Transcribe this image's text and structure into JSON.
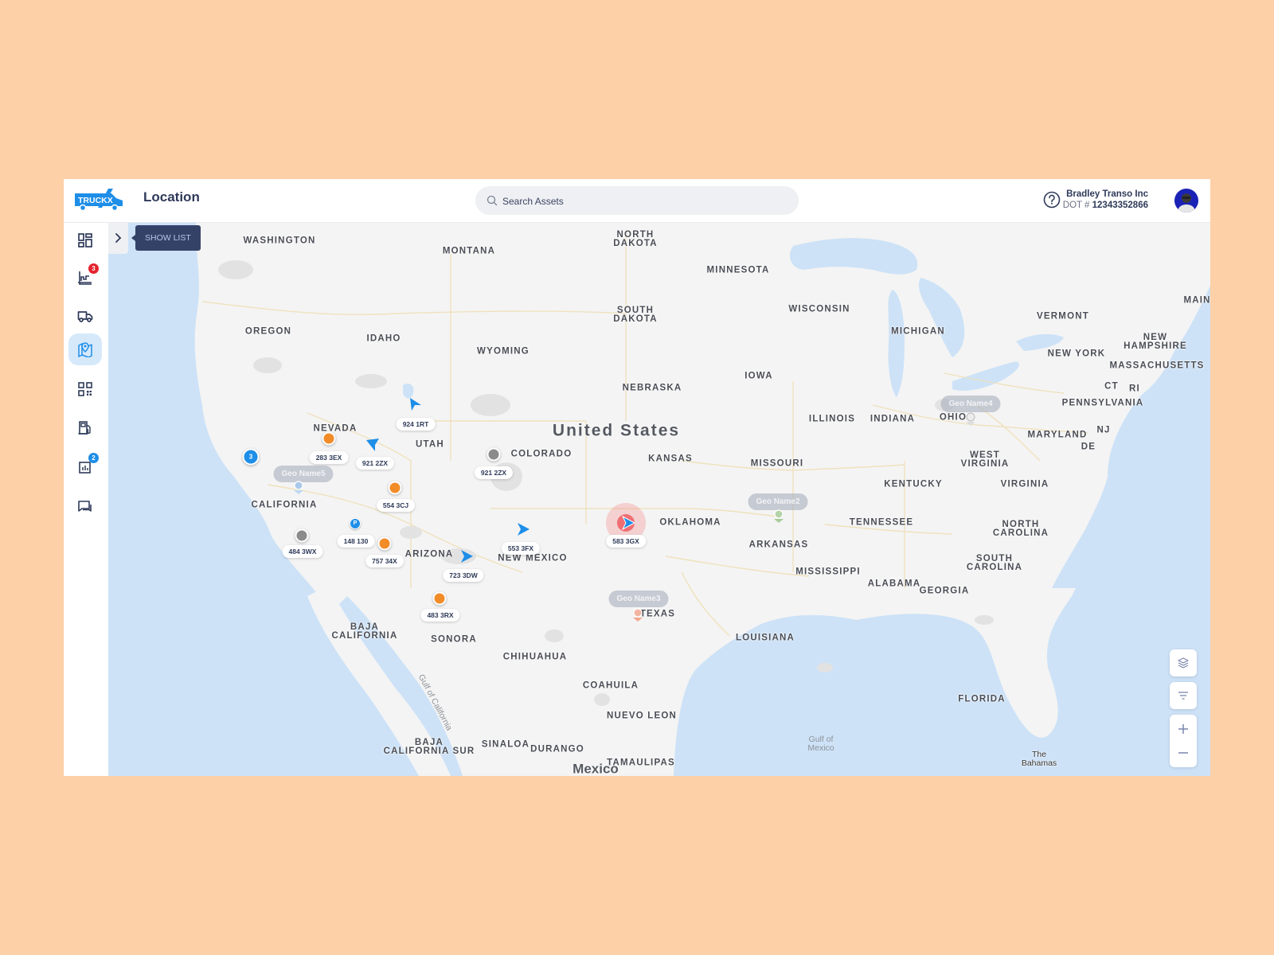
{
  "app": {
    "brand": "TRUCKX",
    "page_title": "Location"
  },
  "search": {
    "placeholder": "Search Assets",
    "value": ""
  },
  "account": {
    "company_name": "Bradley Transo Inc",
    "dot_prefix": "DOT #",
    "dot_number": "12343352866"
  },
  "sidebar": {
    "items": [
      {
        "name": "dashboard",
        "icon": "dashboard-icon",
        "badge": null,
        "active": false
      },
      {
        "name": "analytics",
        "icon": "chart-icon",
        "badge": "3",
        "badge_color": "#e5232e",
        "active": false
      },
      {
        "name": "vehicles",
        "icon": "truck-icon",
        "badge": null,
        "active": false
      },
      {
        "name": "location",
        "icon": "map-pin-icon",
        "badge": null,
        "active": true
      },
      {
        "name": "qr-codes",
        "icon": "qr-code-icon",
        "badge": null,
        "active": false
      },
      {
        "name": "fuel",
        "icon": "fuel-pump-icon",
        "badge": null,
        "active": false
      },
      {
        "name": "reports",
        "icon": "report-icon",
        "badge": "2",
        "badge_color": "#1e8ee8",
        "active": false
      },
      {
        "name": "messages",
        "icon": "chat-icon",
        "badge": null,
        "active": false
      }
    ]
  },
  "map": {
    "show_list_tooltip": "SHOW LIST",
    "country_labels": {
      "us": "United States",
      "mexico": "Mexico"
    },
    "region_labels": {
      "washington": "WASHINGTON",
      "montana": "MONTANA",
      "north_dakota": "NORTH\nDAKOTA",
      "minnesota": "MINNESOTA",
      "oregon": "OREGON",
      "idaho": "IDAHO",
      "south_dakota": "SOUTH\nDAKOTA",
      "wisconsin": "WISCONSIN",
      "michigan": "MICHIGAN",
      "vermont": "VERMONT",
      "maine": "MAINE",
      "new_hampshire": "NEW\nHAMPSHIRE",
      "new_york": "NEW YORK",
      "massachusetts": "MASSACHUSETTS",
      "wyoming": "WYOMING",
      "iowa": "IOWA",
      "nebraska": "NEBRASKA",
      "ct": "CT",
      "ri": "RI",
      "pennsylvania": "PENNSYLVANIA",
      "ohio": "OHIO",
      "illinois": "ILLINOIS",
      "indiana": "INDIANA",
      "nevada": "NEVADA",
      "utah": "UTAH",
      "colorado": "COLORADO",
      "kansas": "KANSAS",
      "missouri": "MISSOURI",
      "nj": "NJ",
      "maryland": "MARYLAND",
      "de": "DE",
      "west_virginia": "WEST\nVIRGINIA",
      "california": "CALIFORNIA",
      "kentucky": "KENTUCKY",
      "virginia": "VIRGINIA",
      "oklahoma": "OKLAHOMA",
      "tennessee": "TENNESSEE",
      "north_carolina": "NORTH\nCAROLINA",
      "arkansas": "ARKANSAS",
      "arizona": "ARIZONA",
      "new_mexico": "NEW MEXICO",
      "south_carolina": "SOUTH\nCAROLINA",
      "mississippi": "MISSISSIPPI",
      "alabama": "ALABAMA",
      "georgia": "GEORGIA",
      "texas": "TEXAS",
      "louisiana": "LOUISIANA",
      "baja_california": "BAJA\nCALIFORNIA",
      "sonora": "SONORA",
      "chihuahua": "CHIHUAHUA",
      "coahuila": "COAHUILA",
      "florida": "FLORIDA",
      "nuevo_leon": "NUEVO LEON",
      "baja_california_sur": "BAJA\nCALIFORNIA SUR",
      "sinaloa": "SINALOA",
      "durango": "DURANGO",
      "tamaulipas": "TAMAULIPAS"
    },
    "water_labels": {
      "gulf_of_california": "Gulf of California",
      "gulf_of_mexico": "Gulf of\nMexico",
      "bahamas": "The\nBahamas"
    },
    "vehicles": [
      {
        "id": "924 1RT",
        "marker": "moving",
        "color": "#1e8ee8"
      },
      {
        "id": "283 3EX",
        "marker": "idle",
        "color": "#f28c28"
      },
      {
        "id": "921 2ZX",
        "marker": "moving",
        "color": "#1e8ee8"
      },
      {
        "id": "921 2ZX",
        "marker": "stopped",
        "color": "#8b8b8b"
      },
      {
        "id": "554 3CJ",
        "marker": "idle",
        "color": "#f28c28"
      },
      {
        "id": "148 130",
        "marker": "parked",
        "color": "#1e8ee8"
      },
      {
        "id": "484 3WX",
        "marker": "stopped",
        "color": "#8b8b8b"
      },
      {
        "id": "757 34X",
        "marker": "idle",
        "color": "#f28c28"
      },
      {
        "id": "723 3DW",
        "marker": "moving",
        "color": "#1e8ee8"
      },
      {
        "id": "553 3FX",
        "marker": "moving",
        "color": "#1e8ee8"
      },
      {
        "id": "583 3GX",
        "marker": "alert",
        "color": "#ef6e73"
      },
      {
        "id": "483 3RX",
        "marker": "idle",
        "color": "#f28c28"
      }
    ],
    "cluster": {
      "count": "3"
    },
    "parked_symbol": "P",
    "geofences": [
      {
        "name": "Geo Name5"
      },
      {
        "name": "Geo Name2"
      },
      {
        "name": "Geo Name3"
      },
      {
        "name": "Geo Name4"
      }
    ],
    "controls": {
      "layers": "layers-icon",
      "filter": "filter-icon",
      "zoom_in": "+",
      "zoom_out": "−"
    }
  }
}
